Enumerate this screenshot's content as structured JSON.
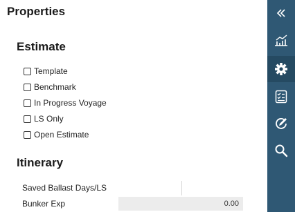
{
  "panel": {
    "title": "Properties",
    "estimate": {
      "heading": "Estimate",
      "checkboxes": [
        {
          "label": "Template",
          "checked": false
        },
        {
          "label": "Benchmark",
          "checked": false
        },
        {
          "label": "In Progress Voyage",
          "checked": false
        },
        {
          "label": "LS Only",
          "checked": false
        },
        {
          "label": "Open Estimate",
          "checked": false
        }
      ]
    },
    "itinerary": {
      "heading": "Itinerary",
      "fields": [
        {
          "label": "Saved Ballast Days/LS",
          "value": ""
        },
        {
          "label": "Bunker Exp",
          "value": "0.00"
        }
      ]
    }
  },
  "sidebar": {
    "items": [
      {
        "icon": "double-chevron-left-icon",
        "active": false
      },
      {
        "icon": "chart-icon",
        "active": false
      },
      {
        "icon": "gear-icon",
        "active": true
      },
      {
        "icon": "checklist-icon",
        "active": false
      },
      {
        "icon": "edit-circle-icon",
        "active": false
      },
      {
        "icon": "search-icon",
        "active": false
      }
    ],
    "active_color": "#254a62",
    "background_color": "#2f5874"
  }
}
